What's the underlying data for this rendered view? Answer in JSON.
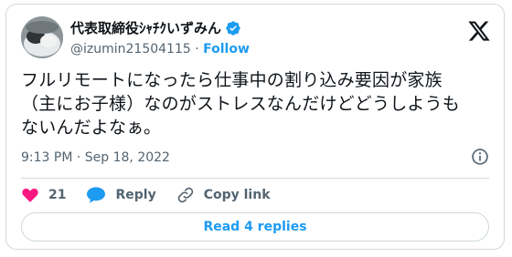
{
  "author": {
    "display_name": "代表取締役ｼｬﾁｸいずみん",
    "handle": "@izumin21504115",
    "separator": "·",
    "follow_label": "Follow",
    "verified_color": "#1d9bf0"
  },
  "tweet": {
    "text": "フルリモートになったら仕事中の割り込み要因が家族\n（主にお子様）なのがストレスなんだけどどうしようも\nないんだよなぁ。",
    "timestamp": "9:13 PM · Sep 18, 2022"
  },
  "actions": {
    "like_count": "21",
    "reply_label": "Reply",
    "copy_link_label": "Copy link"
  },
  "footer": {
    "read_replies_label": "Read 4 replies"
  },
  "icons": {
    "logo": "x-logo-icon",
    "verified": "verified-badge-icon",
    "info": "info-icon",
    "like": "heart-icon",
    "reply": "reply-bubble-icon",
    "copy": "link-icon"
  },
  "colors": {
    "accent": "#1d9bf0",
    "like": "#f91880",
    "text": "#0f1419",
    "muted": "#536471",
    "border": "#cfd9de"
  }
}
